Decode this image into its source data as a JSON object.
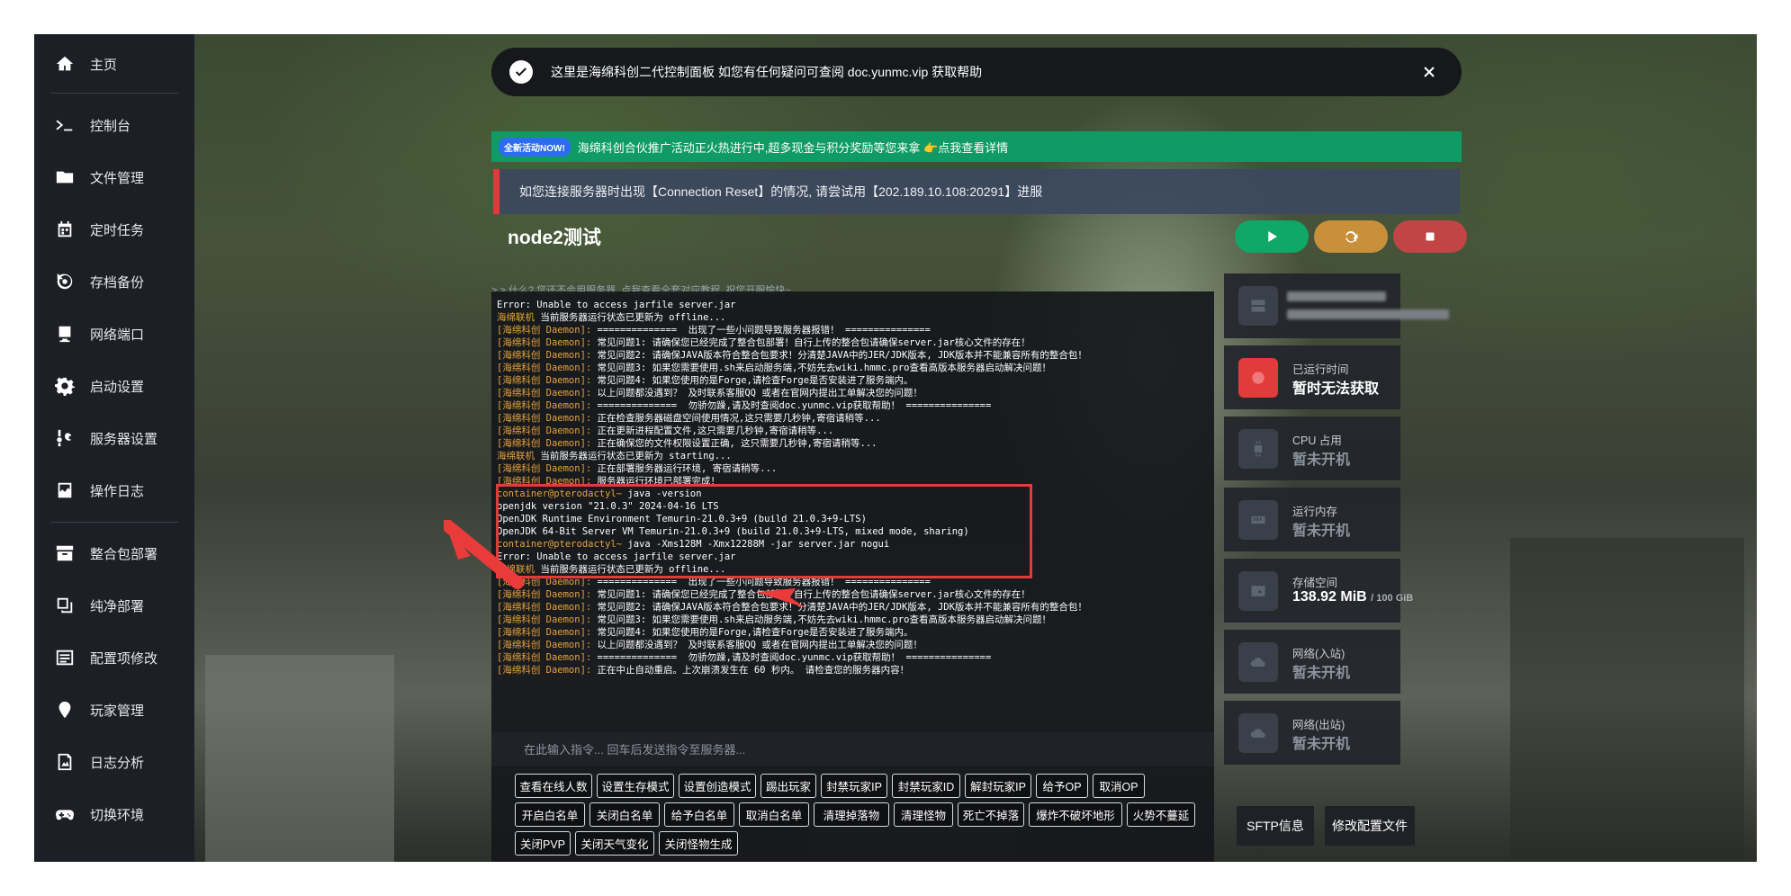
{
  "nav": {
    "items": [
      {
        "label": "主页",
        "icon": "home-icon"
      },
      {
        "label": "控制台",
        "icon": "terminal-icon"
      },
      {
        "label": "文件管理",
        "icon": "folder-icon"
      },
      {
        "label": "定时任务",
        "icon": "calendar-icon"
      },
      {
        "label": "存档备份",
        "icon": "backup-icon"
      },
      {
        "label": "网络端口",
        "icon": "network-icon"
      },
      {
        "label": "启动设置",
        "icon": "gear-icon"
      },
      {
        "label": "服务器设置",
        "icon": "tools-icon"
      },
      {
        "label": "操作日志",
        "icon": "activity-icon"
      },
      {
        "label": "整合包部署",
        "icon": "archive-icon"
      },
      {
        "label": "纯净部署",
        "icon": "copy-icon"
      },
      {
        "label": "配置项修改",
        "icon": "list-icon"
      },
      {
        "label": "玩家管理",
        "icon": "pin-icon"
      },
      {
        "label": "日志分析",
        "icon": "chart-icon"
      },
      {
        "label": "切换环境",
        "icon": "gamepad-icon"
      }
    ]
  },
  "notice": {
    "text": "这里是海绵科创二代控制面板 如您有任何疑问可查阅 doc.yunmc.vip 获取帮助"
  },
  "promo": {
    "badge": "全新活动NOW!",
    "text": "海绵科创合伙推广活动正火热进行中,超多现金与积分奖励等您来拿 👉点我查看详情"
  },
  "connection_notice": {
    "text": "如您连接服务器时出现【Connection Reset】的情况, 请尝试用【202.189.10.108:20291】进服"
  },
  "server": {
    "name": "node2测试"
  },
  "console": {
    "hint": "> > 什么? 您还不会用服务器, 点我查看全套对应教程, 祝您开服愉快~",
    "lines": [
      {
        "prefix": "",
        "text": "Error: Unable to access jarfile server.jar"
      },
      {
        "prefix": "海绵联机",
        "text": " 当前服务器运行状态已更新为 offline..."
      },
      {
        "prefix": "[海绵科创 Daemon]:",
        "text": " ==============  出现了一些小问题导致服务器报错！ ==============="
      },
      {
        "prefix": "[海绵科创 Daemon]:",
        "text": " 常见问题1: 请确保您已经完成了整合包部署！自行上传的整合包请确保server.jar核心文件的存在！"
      },
      {
        "prefix": "[海绵科创 Daemon]:",
        "text": " 常见问题2: 请确保JAVA版本符合整合包要求！分清楚JAVA中的JER/JDK版本, JDK版本并不能兼容所有的整合包！"
      },
      {
        "prefix": "[海绵科创 Daemon]:",
        "text": " 常见问题3: 如果您需要使用.sh来启动服务端,不妨先去wiki.hmmc.pro查看高版本服务器启动解决问题！"
      },
      {
        "prefix": "[海绵科创 Daemon]:",
        "text": " 常见问题4: 如果您使用的是Forge,请检查Forge是否安装进了服务端内。"
      },
      {
        "prefix": "[海绵科创 Daemon]:",
        "text": " 以上问题都没遇到？ 及时联系客服QQ 或者在官网内提出工单解决您的问题！"
      },
      {
        "prefix": "[海绵科创 Daemon]:",
        "text": " ==============  勿骄勿躁,请及时查阅doc.yunmc.vip获取帮助！ ==============="
      },
      {
        "prefix": "[海绵科创 Daemon]:",
        "text": " 正在检查服务器磁盘空间使用情况,这只需要几秒钟,寄宿请稍等..."
      },
      {
        "prefix": "[海绵科创 Daemon]:",
        "text": " 正在更新进程配置文件,这只需要几秒钟,寄宿请稍等..."
      },
      {
        "prefix": "[海绵科创 Daemon]:",
        "text": " 正在确保您的文件权限设置正确, 这只需要几秒钟,寄宿请稍等..."
      },
      {
        "prefix": "海绵联机",
        "text": " 当前服务器运行状态已更新为 starting..."
      },
      {
        "prefix": "[海绵科创 Daemon]:",
        "text": " 正在部署服务器运行环境, 寄宿请稍等..."
      },
      {
        "prefix": "[海绵科创 Daemon]:",
        "text": " 服务器运行环境已部署完成！"
      },
      {
        "prefix": "container@pterodactyl~",
        "text": " java -version"
      },
      {
        "prefix": "",
        "text": "openjdk version \"21.0.3\" 2024-04-16 LTS"
      },
      {
        "prefix": "",
        "text": "OpenJDK Runtime Environment Temurin-21.0.3+9 (build 21.0.3+9-LTS)"
      },
      {
        "prefix": "",
        "text": "OpenJDK 64-Bit Server VM Temurin-21.0.3+9 (build 21.0.3+9-LTS, mixed mode, sharing)"
      },
      {
        "prefix": "container@pterodactyl~",
        "text": " java -Xms128M -Xmx12288M -jar server.jar nogui"
      },
      {
        "prefix": "",
        "text": "Error: Unable to access jarfile server.jar"
      },
      {
        "prefix": "海绵联机",
        "text": " 当前服务器运行状态已更新为 offline..."
      },
      {
        "prefix": "[海绵科创 Daemon]:",
        "text": " ==============  出现了一些小问题导致服务器报错！ ==============="
      },
      {
        "prefix": "[海绵科创 Daemon]:",
        "text": " 常见问题1: 请确保您已经完成了整合包部署！自行上传的整合包请确保server.jar核心文件的存在！"
      },
      {
        "prefix": "[海绵科创 Daemon]:",
        "text": " 常见问题2: 请确保JAVA版本符合整合包要求！分清楚JAVA中的JER/JDK版本, JDK版本并不能兼容所有的整合包！"
      },
      {
        "prefix": "[海绵科创 Daemon]:",
        "text": " 常见问题3: 如果您需要使用.sh来启动服务端,不妨先去wiki.hmmc.pro查看高版本服务器启动解决问题！"
      },
      {
        "prefix": "[海绵科创 Daemon]:",
        "text": " 常见问题4: 如果您使用的是Forge,请检查Forge是否安装进了服务端内。"
      },
      {
        "prefix": "[海绵科创 Daemon]:",
        "text": " 以上问题都没遇到？ 及时联系客服QQ 或者在官网内提出工单解决您的问题！"
      },
      {
        "prefix": "[海绵科创 Daemon]:",
        "text": " ==============  勿骄勿躁,请及时查阅doc.yunmc.vip获取帮助！ ==============="
      },
      {
        "prefix": "[海绵科创 Daemon]:",
        "text": " 正在中止自动重启。上次崩溃发生在 60 秒内。 请检查您的服务器内容！"
      }
    ],
    "input_placeholder": "在此输入指令... 回车后发送指令至服务器..."
  },
  "quick_commands": {
    "rows": [
      [
        "查看在线人数",
        "设置生存模式",
        "设置创造模式",
        "踢出玩家",
        "封禁玩家IP",
        "封禁玩家ID",
        "解封玩家IP",
        "给予OP",
        "取消OP"
      ],
      [
        "开启白名单",
        "关闭白名单",
        "给予白名单",
        "取消白名单",
        "清理掉落物",
        "清理怪物",
        "死亡不掉落",
        "爆炸不破坏地形",
        "火势不蔓延"
      ],
      [
        "关闭PVP",
        "关闭天气变化",
        "关闭怪物生成"
      ]
    ]
  },
  "stats": {
    "uptime": {
      "label": "已运行时间",
      "value": "暂时无法获取"
    },
    "cpu": {
      "label": "CPU 占用",
      "value": "暂未开机"
    },
    "memory": {
      "label": "运行内存",
      "value": "暂未开机"
    },
    "storage": {
      "label": "存储空间",
      "value": "138.92 MiB",
      "limit": "/ 100 GiB"
    },
    "net_in": {
      "label": "网络(入站)",
      "value": "暂未开机"
    },
    "net_out": {
      "label": "网络(出站)",
      "value": "暂未开机"
    }
  },
  "footer_buttons": {
    "sftp": "SFTP信息",
    "config": "修改配置文件"
  },
  "colors": {
    "start": "#0fa866",
    "restart": "#c8903a",
    "stop": "#c24545",
    "promo_bg": "#0f9b63",
    "alert_bar": "#e03a3a",
    "highlight": "#e23b3b"
  }
}
